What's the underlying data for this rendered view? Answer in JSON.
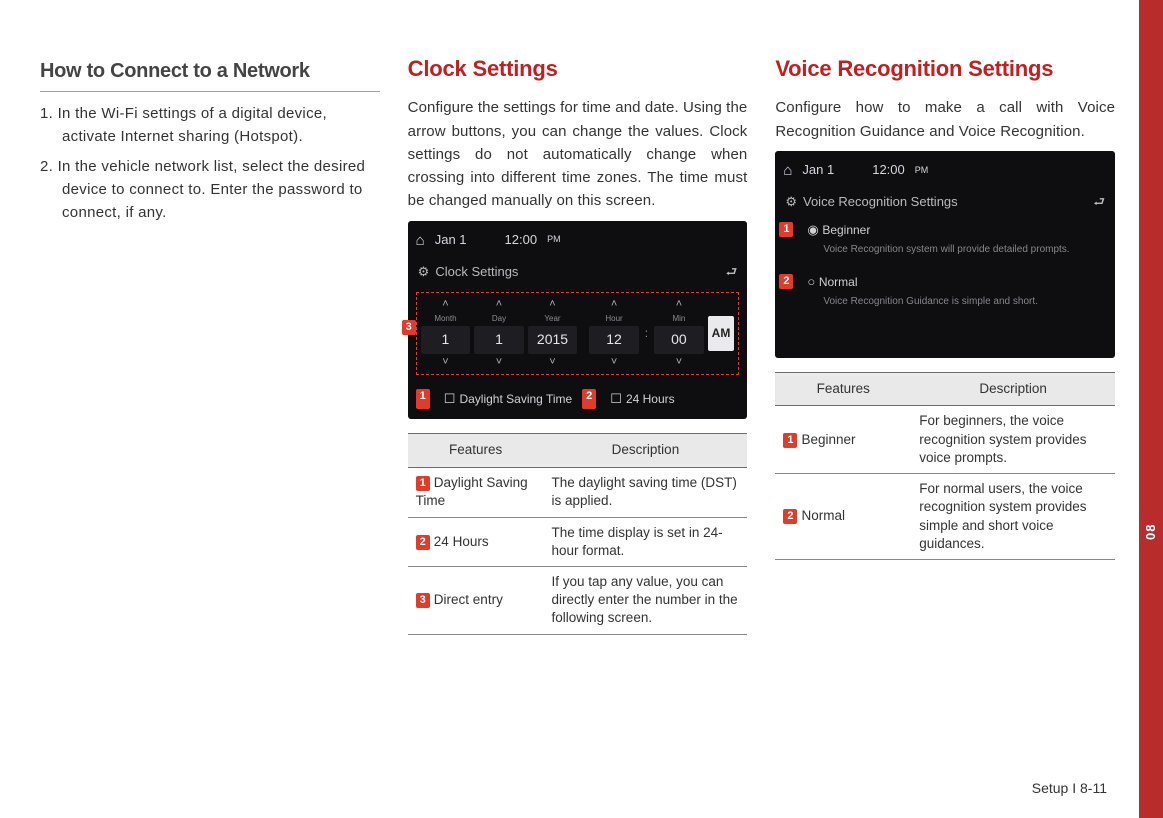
{
  "sideTab": {
    "chapter": "08"
  },
  "col1": {
    "subhead": "How to Connect to a Network",
    "steps": [
      "In the Wi-Fi settings of a digital device, activate Internet sharing (Hotspot).",
      "In the vehicle network list, select the desired device to connect to. Enter the password to connect, if any."
    ]
  },
  "col2": {
    "heading": "Clock Settings",
    "body": "Configure the settings for time and date. Using the arrow buttons, you can change the values. Clock settings do not automatically change when crossing into different time zones. The time must be changed manually on this screen.",
    "screenshot": {
      "topDate": "Jan  1",
      "topTime": "12:00",
      "topTimeSuffix": "PM",
      "title": "Clock Settings",
      "fields": [
        {
          "label": "Month",
          "value": "1"
        },
        {
          "label": "Day",
          "value": "1"
        },
        {
          "label": "Year",
          "value": "2015"
        },
        {
          "label": "Hour",
          "value": "12"
        },
        {
          "label": "Min",
          "value": "00"
        }
      ],
      "ampm": "AM",
      "opt1": "Daylight Saving Time",
      "opt2": "24 Hours"
    },
    "table": {
      "head": [
        "Features",
        "Description"
      ],
      "rows": [
        {
          "num": "1",
          "feat": "Daylight Saving Time",
          "desc": "The daylight saving time (DST) is applied."
        },
        {
          "num": "2",
          "feat": "24 Hours",
          "desc": "The time display is set in 24-hour format."
        },
        {
          "num": "3",
          "feat": "Direct entry",
          "desc": "If you tap any value, you can directly enter the number in the following screen."
        }
      ]
    }
  },
  "col3": {
    "heading": "Voice Recognition Settings",
    "body": "Configure how to make a call with Voice Recognition Guidance and Voice Recognition.",
    "screenshot": {
      "topDate": "Jan  1",
      "topTime": "12:00",
      "topTimeSuffix": "PM",
      "title": "Voice Recognition Settings",
      "opt1": "Beginner",
      "opt1desc": "Voice Recognition system will provide detailed prompts.",
      "opt2": "Normal",
      "opt2desc": "Voice Recognition Guidance is simple and short."
    },
    "table": {
      "head": [
        "Features",
        "Description"
      ],
      "rows": [
        {
          "num": "1",
          "feat": "Beginner",
          "desc": "For beginners, the voice recognition system provides voice prompts."
        },
        {
          "num": "2",
          "feat": "Normal",
          "desc": "For normal users, the voice recognition system provides simple and short voice guidances."
        }
      ]
    }
  },
  "footer": "Setup I 8-11"
}
